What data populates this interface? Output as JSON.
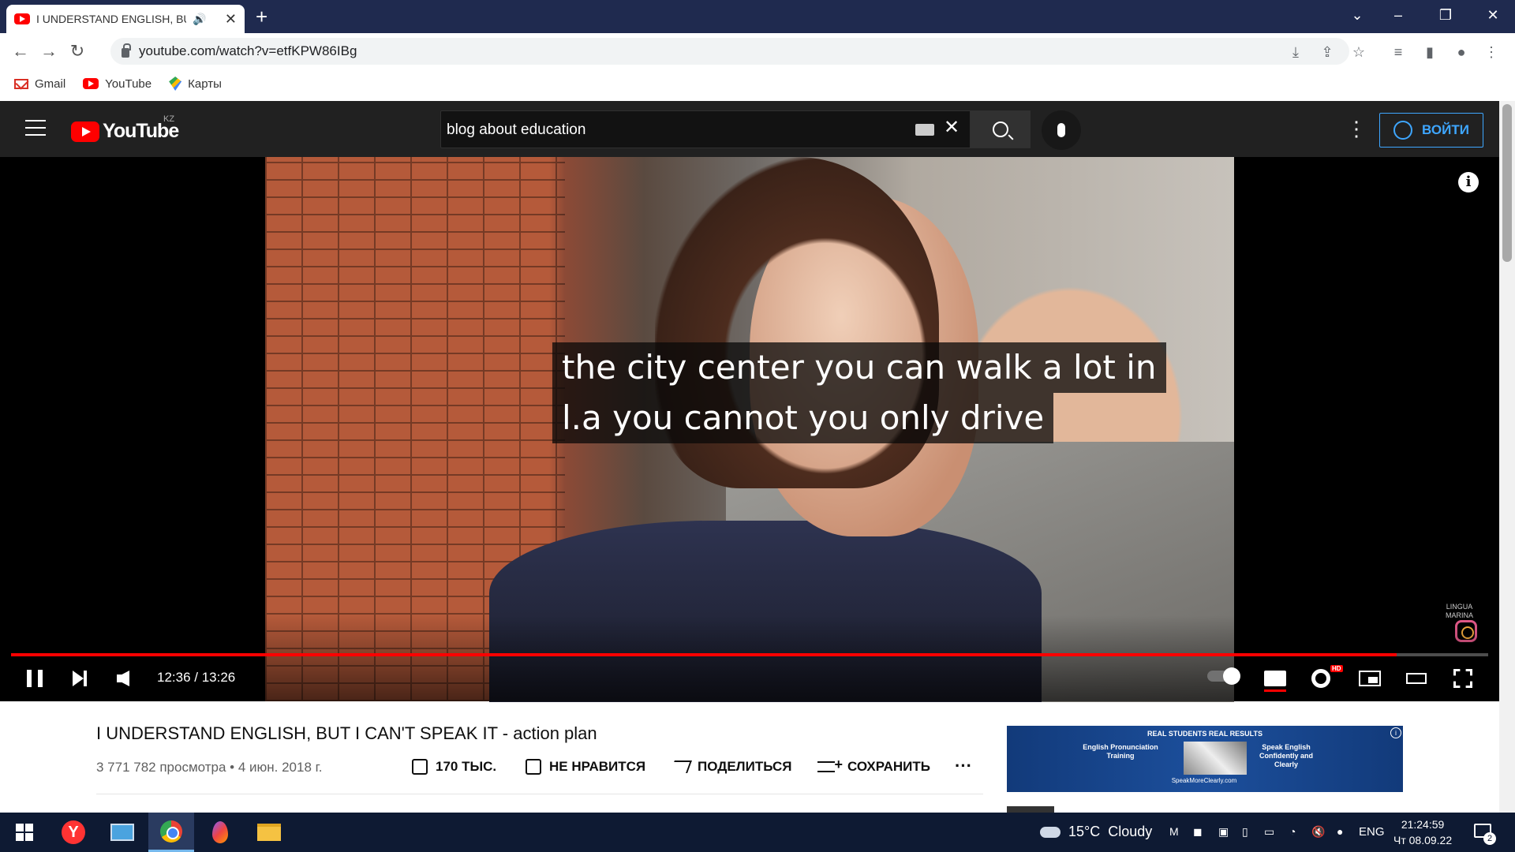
{
  "browser": {
    "tab_title": "I UNDERSTAND ENGLISH, BU",
    "url": "youtube.com/watch?v=etfKPW86IBg",
    "bookmarks": [
      {
        "label": "Gmail",
        "icon": "gmail-icon"
      },
      {
        "label": "YouTube",
        "icon": "youtube-icon"
      },
      {
        "label": "Карты",
        "icon": "maps-icon"
      }
    ]
  },
  "youtube": {
    "logo_text": "YouTube",
    "country_code": "KZ",
    "search_value": "blog about education",
    "signin_label": "ВОЙТИ"
  },
  "player": {
    "subtitle_line1": "the city center you can walk a lot in",
    "subtitle_line2": "l.a you cannot you only drive",
    "current_time": "12:36",
    "duration": "13:26",
    "time_display": "12:36 / 13:26",
    "progress_fraction": 0.938,
    "brand_watermark": "LINGUA\nMARINA",
    "hd_badge": "HD"
  },
  "video": {
    "title": "I UNDERSTAND ENGLISH, BUT I CAN'T SPEAK IT - action plan",
    "meta": "3 771 782 просмотра • 4 июн. 2018 г.",
    "like_label": "170 ТЫС.",
    "dislike_label": "НЕ НРАВИТСЯ",
    "share_label": "ПОДЕЛИТЬСЯ",
    "save_label": "СОХРАНИТЬ"
  },
  "ad": {
    "headline": "REAL STUDENTS REAL RESULTS",
    "left_text": "English Pronunciation Training",
    "right_text": "Speak English Confidently and Clearly",
    "site": "SpeakMoreClearly.com"
  },
  "taskbar": {
    "weather_temp": "15°C",
    "weather_text": "Cloudy",
    "language": "ENG",
    "time": "21:24:59",
    "date": "Чт 08.09.22",
    "notification_count": "2"
  }
}
